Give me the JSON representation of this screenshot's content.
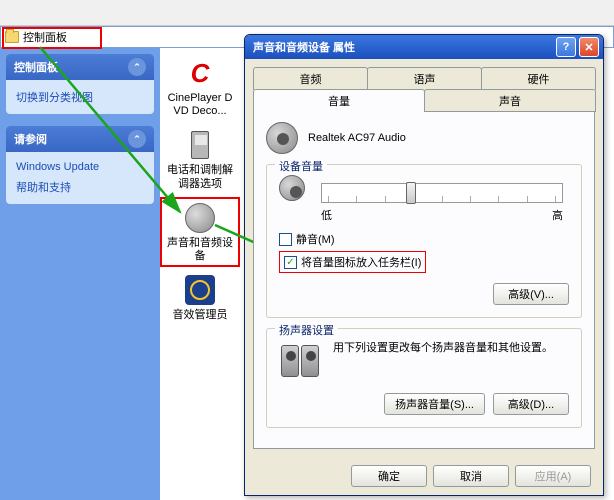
{
  "breadcrumb": {
    "label": "控制面板"
  },
  "sidebar": {
    "panel1_title": "控制面板",
    "panel1_link": "切换到分类视图",
    "panel2_title": "请参阅",
    "panel2_links": [
      "Windows Update",
      "帮助和支持"
    ]
  },
  "cp_items": [
    {
      "label": "CinePlayer DVD Deco..."
    },
    {
      "label": "电话和调制解调器选项"
    },
    {
      "label": "声音和音频设备"
    },
    {
      "label": "音效管理员"
    }
  ],
  "dialog": {
    "title": "声音和音频设备 属性",
    "tabs_row1": [
      "音频",
      "语声",
      "硬件"
    ],
    "tabs_row2": [
      "音量",
      "声音"
    ],
    "device_name": "Realtek AC97 Audio",
    "device_volume": {
      "title": "设备音量",
      "low": "低",
      "high": "高",
      "mute": "静音(M)",
      "taskbar": "将音量图标放入任务栏(I)",
      "advanced": "高级(V)..."
    },
    "speaker_settings": {
      "title": "扬声器设置",
      "desc": "用下列设置更改每个扬声器音量和其他设置。",
      "vol_btn": "扬声器音量(S)...",
      "adv_btn": "高级(D)..."
    },
    "buttons": {
      "ok": "确定",
      "cancel": "取消",
      "apply": "应用(A)"
    }
  }
}
